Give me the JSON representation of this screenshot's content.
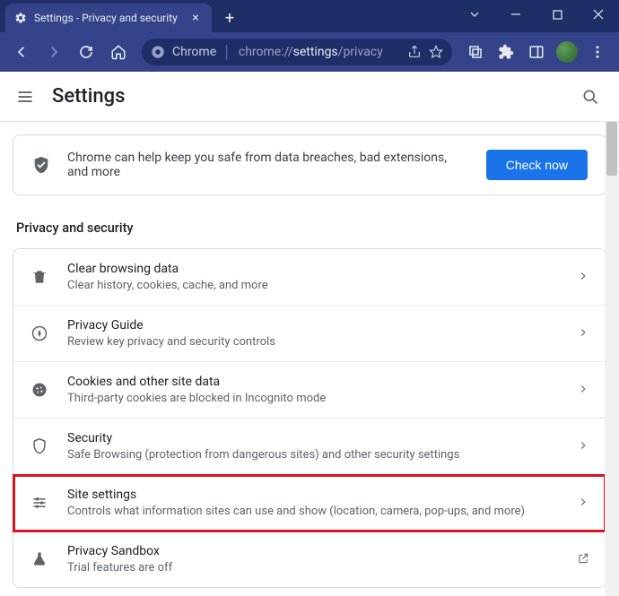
{
  "window": {
    "tab_title": "Settings - Privacy and security"
  },
  "omnibox": {
    "scheme_host": "Chrome",
    "url_dim1": "chrome://",
    "url_bright": "settings",
    "url_dim2": "/privacy"
  },
  "settings_header": {
    "title": "Settings"
  },
  "promo": {
    "text": "Chrome can help keep you safe from data breaches, bad extensions, and more",
    "button": "Check now"
  },
  "section_title": "Privacy and security",
  "rows": [
    {
      "id": "clear-browsing-data",
      "icon": "trash",
      "title": "Clear browsing data",
      "sub": "Clear history, cookies, cache, and more",
      "trailing": "chevron",
      "highlight": false
    },
    {
      "id": "privacy-guide",
      "icon": "compass",
      "title": "Privacy Guide",
      "sub": "Review key privacy and security controls",
      "trailing": "chevron",
      "highlight": false
    },
    {
      "id": "cookies",
      "icon": "cookie",
      "title": "Cookies and other site data",
      "sub": "Third-party cookies are blocked in Incognito mode",
      "trailing": "chevron",
      "highlight": false
    },
    {
      "id": "security",
      "icon": "shield",
      "title": "Security",
      "sub": "Safe Browsing (protection from dangerous sites) and other security settings",
      "trailing": "chevron",
      "highlight": false
    },
    {
      "id": "site-settings",
      "icon": "sliders",
      "title": "Site settings",
      "sub": "Controls what information sites can use and show (location, camera, pop-ups, and more)",
      "trailing": "chevron",
      "highlight": true
    },
    {
      "id": "privacy-sandbox",
      "icon": "flask",
      "title": "Privacy Sandbox",
      "sub": "Trial features are off",
      "trailing": "external",
      "highlight": false
    }
  ]
}
